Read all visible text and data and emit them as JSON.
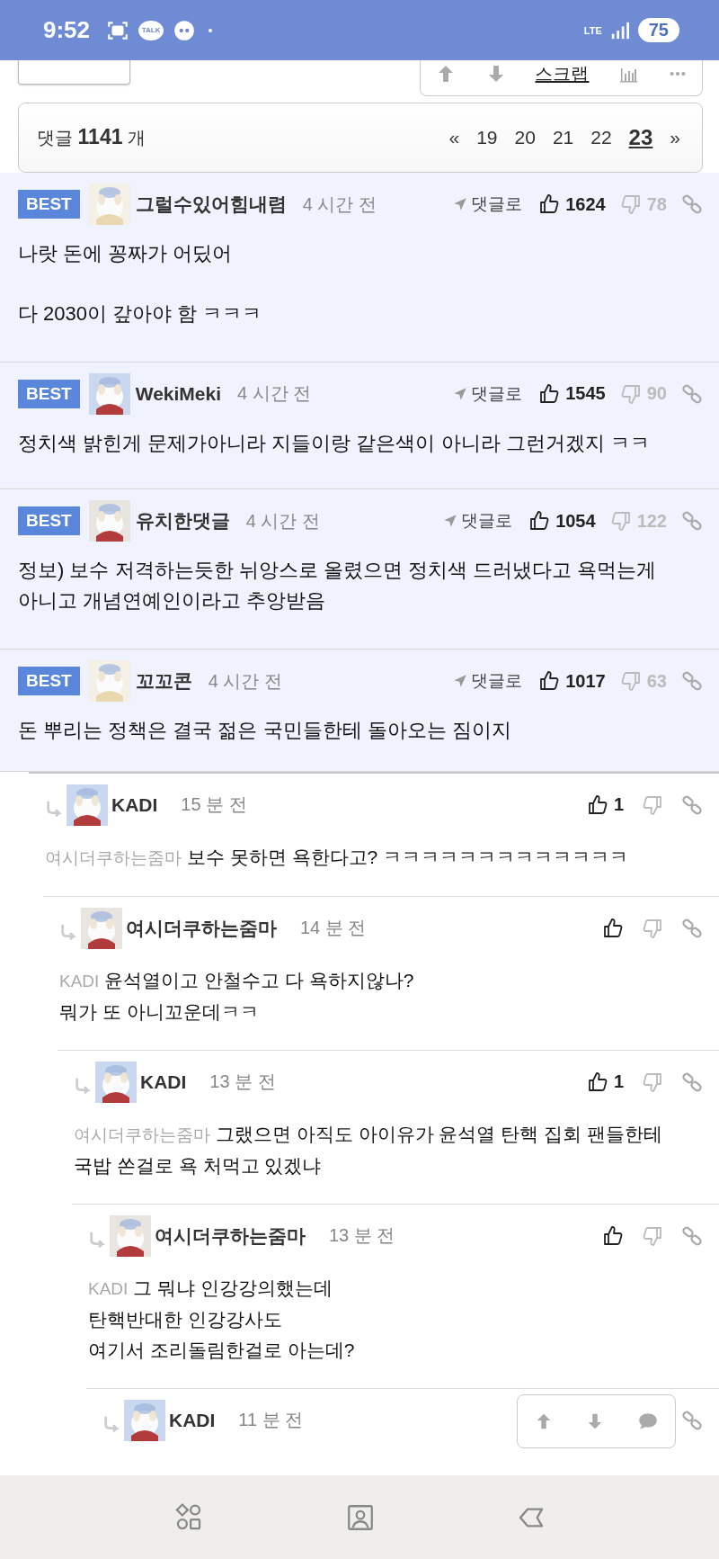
{
  "status_bar": {
    "time": "9:52",
    "talk_badge": "TALK",
    "network": "LTE",
    "battery": "75"
  },
  "toolbar": {
    "scrap": "스크랩"
  },
  "pagination": {
    "count_text": "댓글 **1141** 개",
    "prev": "«",
    "next": "»",
    "pages": [
      {
        "label": "19",
        "selected": false
      },
      {
        "label": "20",
        "selected": false
      },
      {
        "label": "21",
        "selected": false
      },
      {
        "label": "22",
        "selected": false
      },
      {
        "label": "23",
        "selected": true
      }
    ]
  },
  "best_comments": [
    {
      "badge": "BEST",
      "author": "그럴수있어힘내렴",
      "time": "4 시간 전",
      "reply_label": "댓글로",
      "likes": "1624",
      "dislikes": "78",
      "text": "나랏 돈에 꽁짜가 어딨어\n\n다 2030이 갚아야 함 ㅋㅋㅋ"
    },
    {
      "badge": "BEST",
      "author": "WekiMeki",
      "time": "4 시간 전",
      "reply_label": "댓글로",
      "likes": "1545",
      "dislikes": "90",
      "text": "정치색 밝힌게 문제가아니라 지들이랑 같은색이 아니라 그런거겠지 ㅋㅋ"
    },
    {
      "badge": "BEST",
      "author": "유치한댓글",
      "time": "4 시간 전",
      "reply_label": "댓글로",
      "likes": "1054",
      "dislikes": "122",
      "text": "정보) 보수 저격하는듯한 뉘앙스로 올렸으면 정치색 드러냈다고 욕먹는게 아니고 개념연예인이라고 추앙받음"
    },
    {
      "badge": "BEST",
      "author": "꼬꼬콘",
      "time": "4 시간 전",
      "reply_label": "댓글로",
      "likes": "1017",
      "dislikes": "63",
      "text": "돈 뿌리는 정책은 결국 젊은 국민들한테 돌아오는 짐이지"
    }
  ],
  "replies": [
    {
      "author": "KADI",
      "time": "15 분 전",
      "likes": "1",
      "mention": "여시더쿠하는줌마",
      "text": "보수 못하면 욕한다고? ㅋㅋㅋㅋㅋㅋㅋㅋㅋㅋㅋㅋㅋ",
      "children": [
        {
          "author": "여시더쿠하는줌마",
          "time": "14 분 전",
          "mention": "KADI",
          "text": "윤석열이고 안철수고 다 욕하지않나?\n뭐가 또 아니꼬운데ㅋㅋ",
          "children": [
            {
              "author": "KADI",
              "time": "13 분 전",
              "likes": "1",
              "mention": "여시더쿠하는줌마",
              "text": "그랬으면 아직도 아이유가 윤석열 탄핵 집회 팬들한테 국밥 쏜걸로 욕 처먹고 있겠냐",
              "children": [
                {
                  "author": "여시더쿠하는줌마",
                  "time": "13 분 전",
                  "mention": "KADI",
                  "text": "그 뭐냐 인강강의했는데\n탄핵반대한 인강강사도\n여기서 조리돌림한걸로 아는데?",
                  "children": [
                    {
                      "author": "KADI",
                      "time": "11 분 전"
                    }
                  ]
                }
              ]
            }
          ]
        }
      ]
    }
  ]
}
